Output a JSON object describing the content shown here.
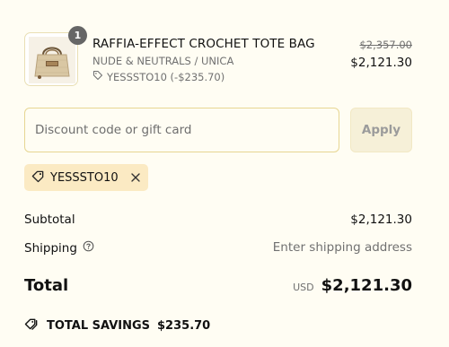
{
  "product": {
    "quantity": "1",
    "title": "RAFFIA-EFFECT CROCHET TOTE BAG",
    "variant": "NUDE & NEUTRALS / UNICA",
    "discount_line": "YESSSTO10 (-$235.70)",
    "original_price": "$2,357.00",
    "price": "$2,121.30"
  },
  "discount": {
    "placeholder": "Discount code or gift card",
    "apply_label": "Apply",
    "applied_code": "YESSSTO10"
  },
  "summary": {
    "subtotal_label": "Subtotal",
    "subtotal_value": "$2,121.30",
    "shipping_label": "Shipping",
    "shipping_value": "Enter shipping address",
    "total_label": "Total",
    "currency": "USD",
    "total_value": "$2,121.30",
    "savings_label": "TOTAL SAVINGS",
    "savings_value": "$235.70"
  },
  "colors": {
    "background": "#fffdf3",
    "chip_bg": "#fbeac3",
    "input_border": "#e7d693",
    "apply_bg": "#f6f0d8"
  },
  "icons": {
    "tag": "tag-icon",
    "close": "close-icon",
    "help": "question-circle-icon",
    "savings": "tags-icon"
  }
}
